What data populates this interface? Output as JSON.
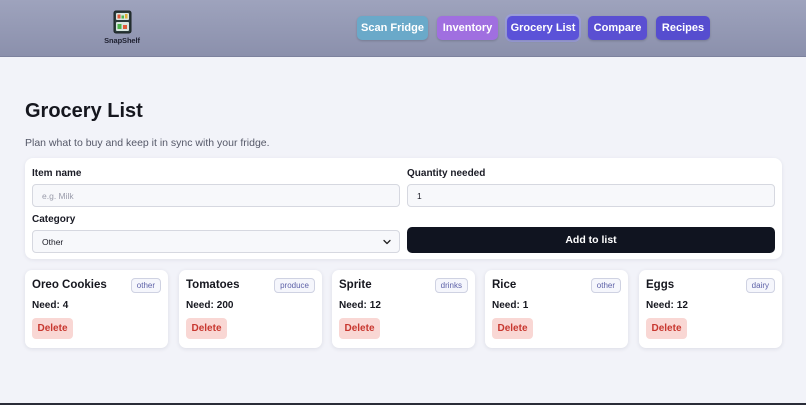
{
  "app": {
    "logo_text": "SnapShelf"
  },
  "nav": [
    {
      "label": "Scan Fridge"
    },
    {
      "label": "Inventory"
    },
    {
      "label": "Grocery List"
    },
    {
      "label": "Compare"
    },
    {
      "label": "Recipes"
    }
  ],
  "page": {
    "title": "Grocery List",
    "subtitle": "Plan what to buy and keep it in sync with your fridge."
  },
  "form": {
    "item_name_label": "Item name",
    "item_name_placeholder": "e.g. Milk",
    "item_name_value": "",
    "quantity_label": "Quantity needed",
    "quantity_value": "1",
    "category_label": "Category",
    "category_selected": "Other",
    "add_label": "Add to list"
  },
  "items": [
    {
      "name": "Oreo Cookies",
      "tag": "other",
      "need_label": "Need:",
      "need": "4",
      "delete_label": "Delete"
    },
    {
      "name": "Tomatoes",
      "tag": "produce",
      "need_label": "Need:",
      "need": "200",
      "delete_label": "Delete"
    },
    {
      "name": "Sprite",
      "tag": "drinks",
      "need_label": "Need:",
      "need": "12",
      "delete_label": "Delete"
    },
    {
      "name": "Rice",
      "tag": "other",
      "need_label": "Need:",
      "need": "1",
      "delete_label": "Delete"
    },
    {
      "name": "Eggs",
      "tag": "dairy",
      "need_label": "Need:",
      "need": "12",
      "delete_label": "Delete"
    }
  ],
  "colors": {
    "header_bg": "#9ea3bd",
    "nav_scan": "#6aa9c9",
    "nav_inventory": "#a06fe0",
    "nav_active": "#5b52d8",
    "add_button": "#101420",
    "delete_bg": "#f9d7d4",
    "delete_text": "#c8372f"
  }
}
